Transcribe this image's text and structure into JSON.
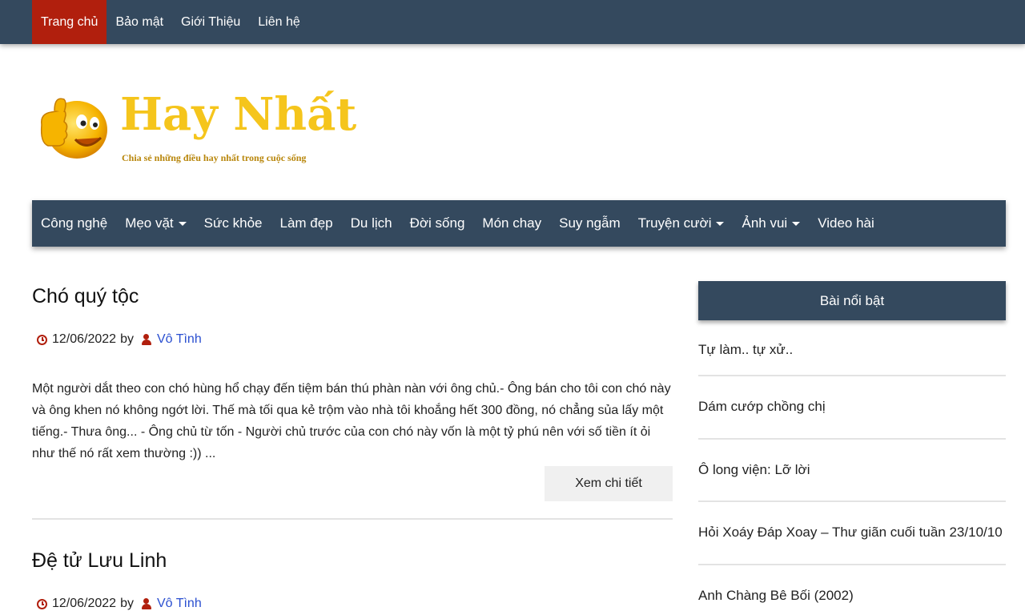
{
  "top_menu": [
    {
      "label": "Trang chủ",
      "active": true
    },
    {
      "label": "Bảo mật"
    },
    {
      "label": "Giới Thiệu"
    },
    {
      "label": "Liên hệ"
    }
  ],
  "logo": {
    "title": "Hay Nhất",
    "tagline": "Chia sẻ những điều hay nhất trong cuộc sống"
  },
  "category_nav": [
    {
      "label": "Công nghệ",
      "dropdown": false
    },
    {
      "label": "Mẹo vặt",
      "dropdown": true
    },
    {
      "label": "Sức khỏe",
      "dropdown": false
    },
    {
      "label": "Làm đẹp",
      "dropdown": false
    },
    {
      "label": "Du lịch",
      "dropdown": false
    },
    {
      "label": "Đời sống",
      "dropdown": false
    },
    {
      "label": "Món chay",
      "dropdown": false
    },
    {
      "label": "Suy ngẫm",
      "dropdown": false
    },
    {
      "label": "Truyện cười",
      "dropdown": true
    },
    {
      "label": "Ảnh vui",
      "dropdown": true
    },
    {
      "label": "Video hài",
      "dropdown": false
    }
  ],
  "posts": [
    {
      "title": "Chó quý tộc",
      "date": "12/06/2022",
      "by": "by",
      "author": "Vô Tình",
      "excerpt": "Một người dắt theo con chó hùng hổ chạy đến tiệm bán thú phàn nàn với ông chủ.- Ông bán cho tôi con chó này và ông khen nó không ngớt lời. Thế mà tối qua kẻ trộm vào nhà tôi khoắng hết 300 đồng, nó chẳng sủa lấy một tiếng.- Thưa ông... - Ông chủ từ tốn - Người chủ trước của con chó này vốn là một tỷ phú nên với số tiền ít ỏi như thế nó rất xem thường :)) ...",
      "more_label": "Xem chi tiết"
    },
    {
      "title": "Đệ tử Lưu Linh",
      "date": "12/06/2022",
      "by": "by",
      "author": "Vô Tình"
    }
  ],
  "sidebar": {
    "heading": "Bài nổi bật",
    "items": [
      "Tự làm.. tự xử..",
      "Dám cướp chồng chị",
      "Ô long viện: Lỡ lời",
      "Hỏi Xoáy Đáp Xoay – Thư giãn cuối tuần 23/10/10",
      "Anh Chàng Bê Bối (2002)"
    ]
  },
  "colors": {
    "nav_bg": "#34495e",
    "active_bg": "#b11f0d",
    "link": "#2a4fd0",
    "logo_yellow": "#f5c51c"
  }
}
